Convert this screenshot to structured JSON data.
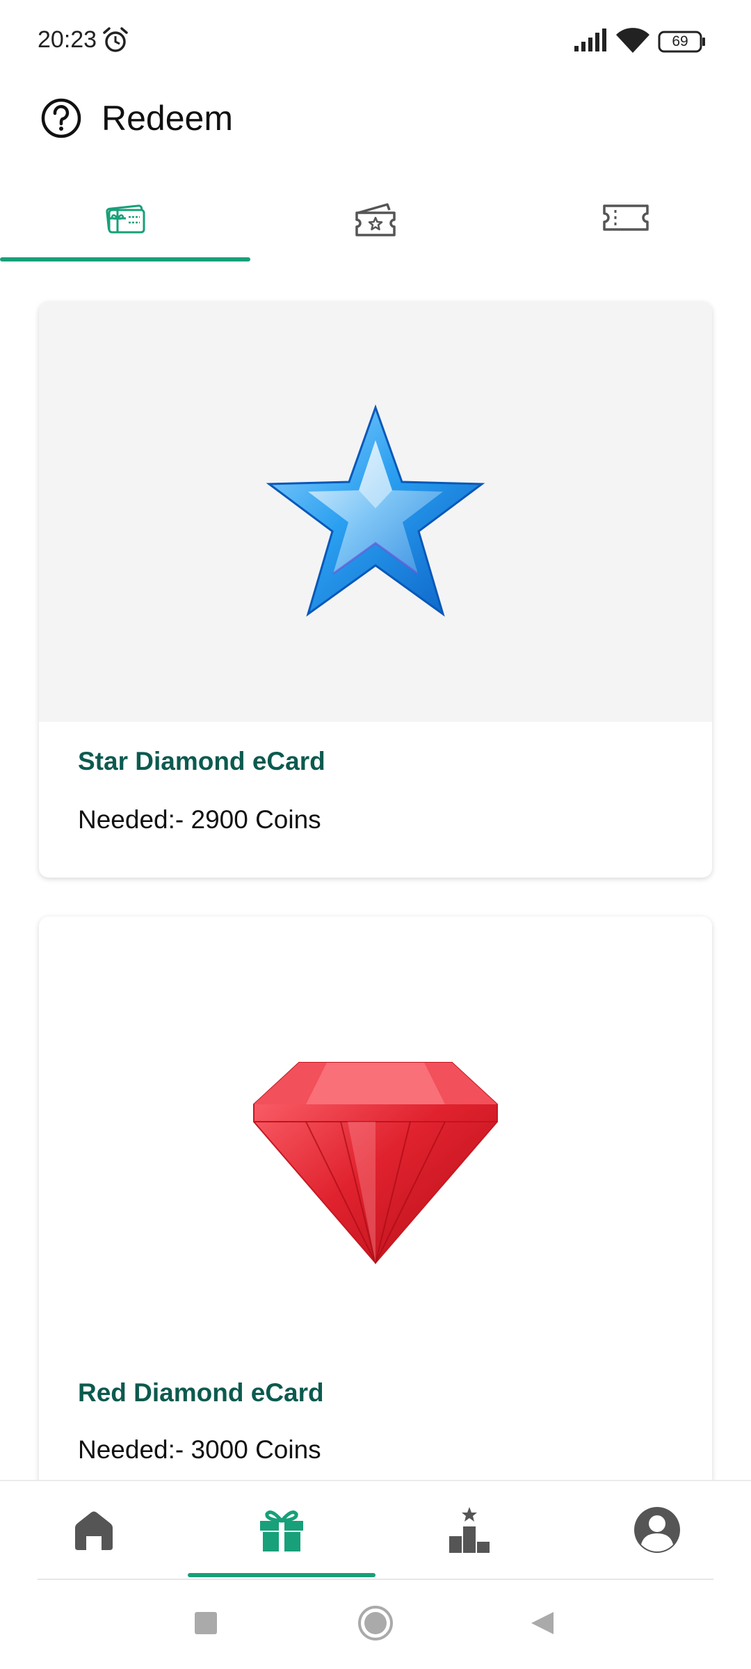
{
  "status_bar": {
    "time": "20:23",
    "battery": "69",
    "icons": [
      "alarm-icon",
      "signal-icon",
      "wifi-icon",
      "battery-icon"
    ]
  },
  "header": {
    "title": "Redeem",
    "icon": "help-icon"
  },
  "tabs": [
    {
      "icon": "gift-card-icon",
      "selected": true
    },
    {
      "icon": "ticket-star-icon",
      "selected": false
    },
    {
      "icon": "coupon-icon",
      "selected": false
    }
  ],
  "cards": [
    {
      "title": "Star Diamond eCard",
      "needed": "Needed:- 2900 Coins",
      "image": "blue-star-gem"
    },
    {
      "title": "Red Diamond eCard",
      "needed": "Needed:- 3000 Coins",
      "image": "red-diamond-gem"
    }
  ],
  "bottom_nav": [
    {
      "icon": "home-icon",
      "selected": false
    },
    {
      "icon": "gift-icon",
      "selected": true
    },
    {
      "icon": "leaderboard-icon",
      "selected": false
    },
    {
      "icon": "profile-icon",
      "selected": false
    }
  ],
  "colors": {
    "accent": "#17a079",
    "title_text": "#0c5a4f",
    "icon_gray": "#555555",
    "card_image_bg": "#f4f4f4"
  }
}
